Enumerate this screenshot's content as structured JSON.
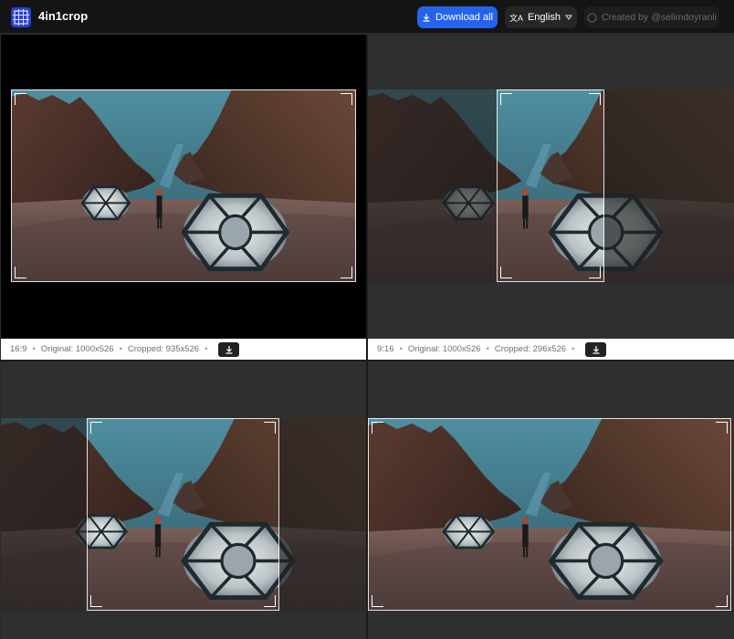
{
  "app": {
    "title": "4in1crop",
    "logo_icon": "crop-grid-icon"
  },
  "header": {
    "download_all_label": "Download all",
    "language_label": "English",
    "credit_label": "Created by @selimdoyranli"
  },
  "panels": [
    {
      "ratio": "16:9",
      "original": "Original: 1000x526",
      "cropped": "Cropped: 935x526"
    },
    {
      "ratio": "9:16",
      "original": "Original: 1000x526",
      "cropped": "Cropped: 296x526"
    },
    {
      "ratio": "",
      "original": "",
      "cropped": ""
    },
    {
      "ratio": "",
      "original": "",
      "cropped": ""
    }
  ],
  "colors": {
    "accent": "#2563eb",
    "header_bg": "#141414",
    "panel_bg": "#2f2f2f"
  }
}
